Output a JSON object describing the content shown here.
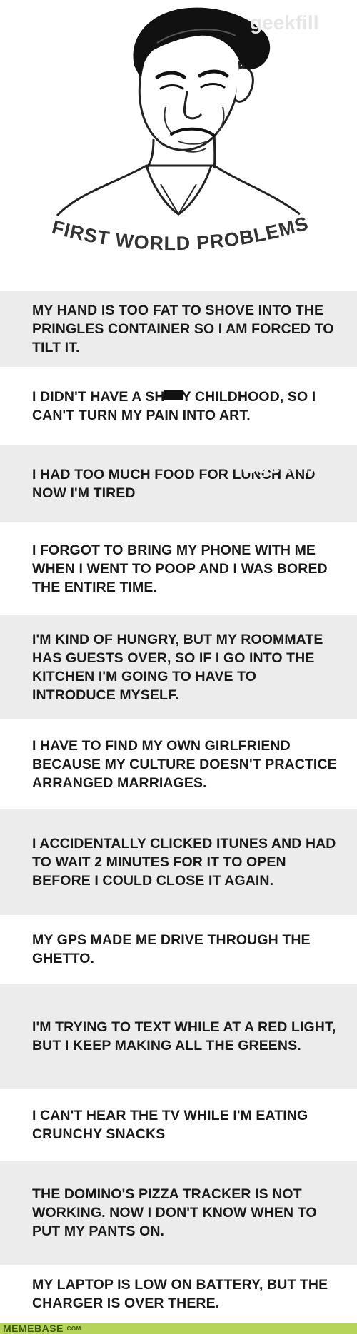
{
  "header": {
    "title": "FIRST WORLD PROBLEMS",
    "watermark": "geekfill"
  },
  "problems": [
    {
      "text": "MY HAND IS TOO FAT TO SHOVE INTO THE PRINGLES CONTAINER SO I AM FORCED TO TILT IT."
    },
    {
      "text_before": "I DIDN'T HAVE A SH",
      "text_after": "Y CHILDHOOD, SO I CAN'T TURN MY PAIN INTO ART."
    },
    {
      "text": "I HAD TOO MUCH FOOD FOR LUNCH AND NOW I'M TIRED"
    },
    {
      "text": "I FORGOT TO BRING MY PHONE WITH ME WHEN I WENT TO POOP AND I WAS BORED THE ENTIRE TIME."
    },
    {
      "text": "I'M KIND OF HUNGRY, BUT MY ROOMMATE HAS GUESTS OVER, SO IF I GO INTO THE KITCHEN I'M GOING TO HAVE TO INTRODUCE MYSELF."
    },
    {
      "text": "I HAVE TO FIND MY OWN GIRLFRIEND BECAUSE MY CULTURE DOESN'T PRACTICE ARRANGED MARRIAGES."
    },
    {
      "text": "I ACCIDENTALLY CLICKED ITUNES AND HAD TO WAIT 2 MINUTES FOR IT TO OPEN BEFORE I COULD CLOSE IT AGAIN."
    },
    {
      "text": "MY GPS MADE ME DRIVE THROUGH THE GHETTO."
    },
    {
      "text": "I'M TRYING TO TEXT WHILE AT A RED LIGHT, BUT I KEEP MAKING ALL THE GREENS."
    },
    {
      "text": "I CAN'T HEAR THE TV WHILE I'M EATING CRUNCHY SNACKS"
    },
    {
      "text": "THE DOMINO'S PIZZA TRACKER IS NOT WORKING. NOW I DON'T KNOW WHEN TO PUT MY PANTS ON."
    },
    {
      "text": "MY LAPTOP IS LOW ON BATTERY, BUT THE CHARGER IS OVER THERE."
    }
  ],
  "footer": {
    "brand": "MEMEBASE",
    "suffix": ".COM"
  }
}
